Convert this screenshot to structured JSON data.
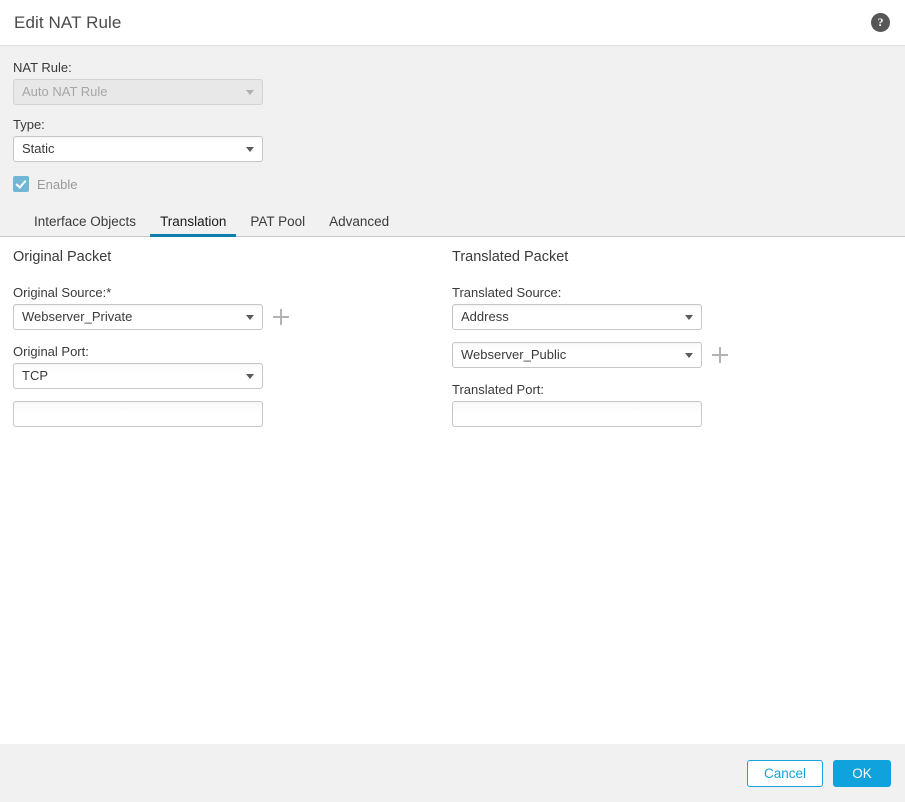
{
  "header": {
    "title": "Edit NAT Rule",
    "help_icon": "help-circle-icon",
    "help_glyph": "?"
  },
  "top": {
    "nat_rule_label": "NAT Rule:",
    "nat_rule_value": "Auto NAT Rule",
    "nat_rule_disabled": true,
    "type_label": "Type:",
    "type_value": "Static",
    "enable_label": "Enable",
    "enable_checked": true,
    "enable_disabled": true
  },
  "tabs": [
    {
      "label": "Interface Objects",
      "active": false
    },
    {
      "label": "Translation",
      "active": true
    },
    {
      "label": "PAT Pool",
      "active": false
    },
    {
      "label": "Advanced",
      "active": false
    }
  ],
  "original_packet": {
    "title": "Original Packet",
    "source_label": "Original Source:*",
    "source_value": "Webserver_Private",
    "add_source_icon": "plus-icon",
    "port_label": "Original Port:",
    "port_protocol_value": "TCP",
    "port_value": "",
    "port_placeholder": ""
  },
  "translated_packet": {
    "title": "Translated Packet",
    "source_label": "Translated Source:",
    "source_type_value": "Address",
    "source_object_value": "Webserver_Public",
    "add_source_icon": "plus-icon",
    "port_label": "Translated Port:",
    "port_value": "",
    "port_placeholder": ""
  },
  "footer": {
    "cancel_label": "Cancel",
    "ok_label": "OK"
  },
  "colors": {
    "accent_blue": "#0fa2dc",
    "tab_underline": "#0d80ae",
    "checkbox_blue": "#72b6d4",
    "panel_gray": "#f1f1f1"
  }
}
